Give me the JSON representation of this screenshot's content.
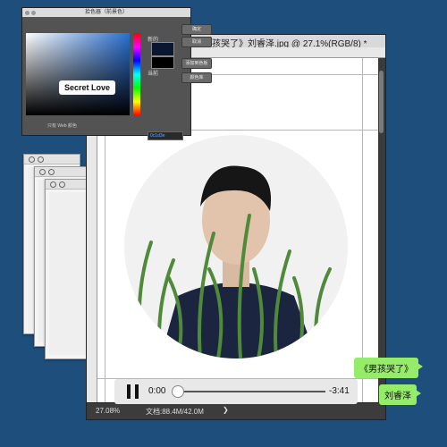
{
  "document_window": {
    "title": "《男孩哭了》刘睿泽.jpg @ 27.1%(RGB/8) *",
    "status_zoom": "27.08%",
    "status_doc": "文档:88.4M/42.0M",
    "status_arrow": "❯"
  },
  "player": {
    "current_time": "0:00",
    "remaining_time": "-3:41",
    "progress": 0.0
  },
  "chat_bubbles": [
    {
      "text": "《男孩哭了》"
    },
    {
      "text": "刘睿泽"
    }
  ],
  "color_picker": {
    "title": "拾色器（前景色）",
    "buttons": {
      "ok": "确定",
      "cancel": "取消",
      "add_swatch": "添加到色板",
      "color_library": "颜色库"
    },
    "label_new": "新的",
    "label_current": "当前",
    "web_only": "只有 Web 颜色",
    "tooltip": "Secret Love",
    "hex": "0c1d3e",
    "accent": "#0c1d3e"
  },
  "colors": {
    "background": "#1d4e7c",
    "bubble": "#95ec69",
    "guide": "#6ad6e0"
  }
}
